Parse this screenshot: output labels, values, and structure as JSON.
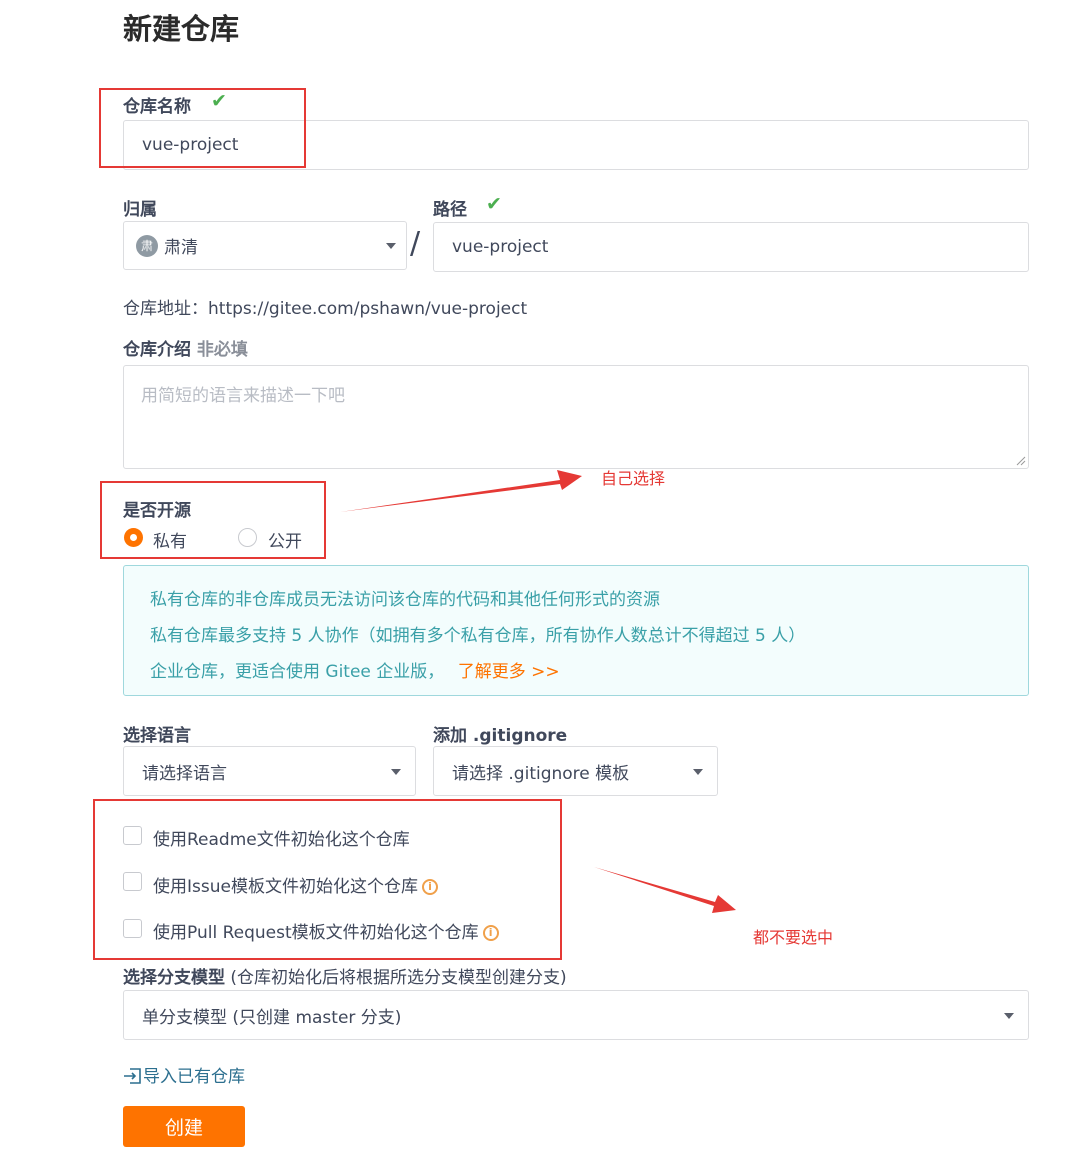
{
  "page": {
    "title": "新建仓库"
  },
  "repo_name": {
    "label": "仓库名称",
    "value": "vue-project"
  },
  "owner": {
    "label": "归属",
    "value": "肃清",
    "avatar_char": "肃"
  },
  "separator": "/",
  "path": {
    "label": "路径",
    "value": "vue-project"
  },
  "repo_address": {
    "text": "仓库地址：https://gitee.com/pshawn/vue-project"
  },
  "description": {
    "label": "仓库介绍",
    "optional": "非必填",
    "placeholder": "用简短的语言来描述一下吧"
  },
  "visibility": {
    "label": "是否开源",
    "options": [
      {
        "label": "私有",
        "selected": true
      },
      {
        "label": "公开",
        "selected": false
      }
    ]
  },
  "info": {
    "line1": "私有仓库的非仓库成员无法访问该仓库的代码和其他任何形式的资源",
    "line2": "私有仓库最多支持 5 人协作（如拥有多个私有仓库，所有协作人数总计不得超过 5 人）",
    "line3": "企业仓库，更适合使用 Gitee 企业版，",
    "link": "了解更多 >>"
  },
  "language": {
    "label": "选择语言",
    "value": "请选择语言"
  },
  "gitignore": {
    "label": "添加 .gitignore",
    "value": "请选择 .gitignore 模板"
  },
  "checkboxes": [
    {
      "label": "使用Readme文件初始化这个仓库",
      "checked": false
    },
    {
      "label": "使用Issue模板文件初始化这个仓库",
      "checked": false
    },
    {
      "label": "使用Pull Request模板文件初始化这个仓库",
      "checked": false
    }
  ],
  "branch_model": {
    "label": "选择分支模型",
    "hint": "(仓库初始化后将根据所选分支模型创建分支)",
    "value": "单分支模型 (只创建 master 分支)"
  },
  "import_link": "导入已有仓库",
  "create_button": "创建",
  "annotations": {
    "choose_self": "自己选择",
    "dont_select": "都不要选中"
  },
  "colors": {
    "accent": "#fe7300",
    "success": "#4caf50",
    "annotation": "#e53935",
    "info": "#3aa0a8"
  }
}
